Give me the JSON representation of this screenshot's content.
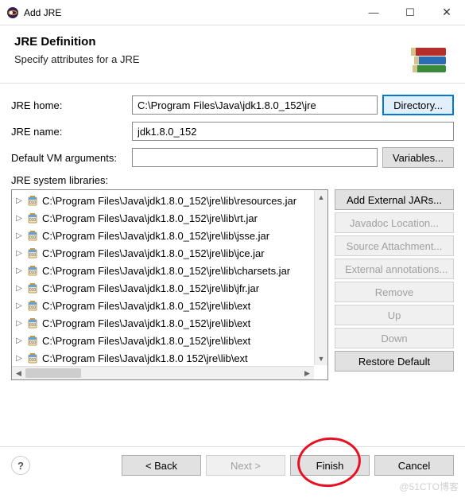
{
  "window": {
    "title": "Add JRE",
    "minimize": "—",
    "maximize": "☐",
    "close": "✕"
  },
  "header": {
    "title": "JRE Definition",
    "subtitle": "Specify attributes for a JRE"
  },
  "form": {
    "jre_home_label": "JRE home:",
    "jre_home_value": "C:\\Program Files\\Java\\jdk1.8.0_152\\jre",
    "directory_btn": "Directory...",
    "jre_name_label": "JRE name:",
    "jre_name_value": "jdk1.8.0_152",
    "vm_args_label": "Default VM arguments:",
    "vm_args_value": "",
    "variables_btn": "Variables...",
    "libs_label": "JRE system libraries:"
  },
  "libraries": [
    "C:\\Program Files\\Java\\jdk1.8.0_152\\jre\\lib\\resources.jar",
    "C:\\Program Files\\Java\\jdk1.8.0_152\\jre\\lib\\rt.jar",
    "C:\\Program Files\\Java\\jdk1.8.0_152\\jre\\lib\\jsse.jar",
    "C:\\Program Files\\Java\\jdk1.8.0_152\\jre\\lib\\jce.jar",
    "C:\\Program Files\\Java\\jdk1.8.0_152\\jre\\lib\\charsets.jar",
    "C:\\Program Files\\Java\\jdk1.8.0_152\\jre\\lib\\jfr.jar",
    "C:\\Program Files\\Java\\jdk1.8.0_152\\jre\\lib\\ext",
    "C:\\Program Files\\Java\\jdk1.8.0_152\\jre\\lib\\ext",
    "C:\\Program Files\\Java\\jdk1.8.0_152\\jre\\lib\\ext",
    "C:\\Program Files\\Java\\jdk1.8.0 152\\jre\\lib\\ext"
  ],
  "lib_buttons": {
    "add_external": "Add External JARs...",
    "javadoc": "Javadoc Location...",
    "source": "Source Attachment...",
    "annotations": "External annotations...",
    "remove": "Remove",
    "up": "Up",
    "down": "Down",
    "restore": "Restore Default"
  },
  "footer": {
    "help": "?",
    "back": "< Back",
    "next": "Next >",
    "finish": "Finish",
    "cancel": "Cancel"
  },
  "watermark": "@51CTO博客"
}
